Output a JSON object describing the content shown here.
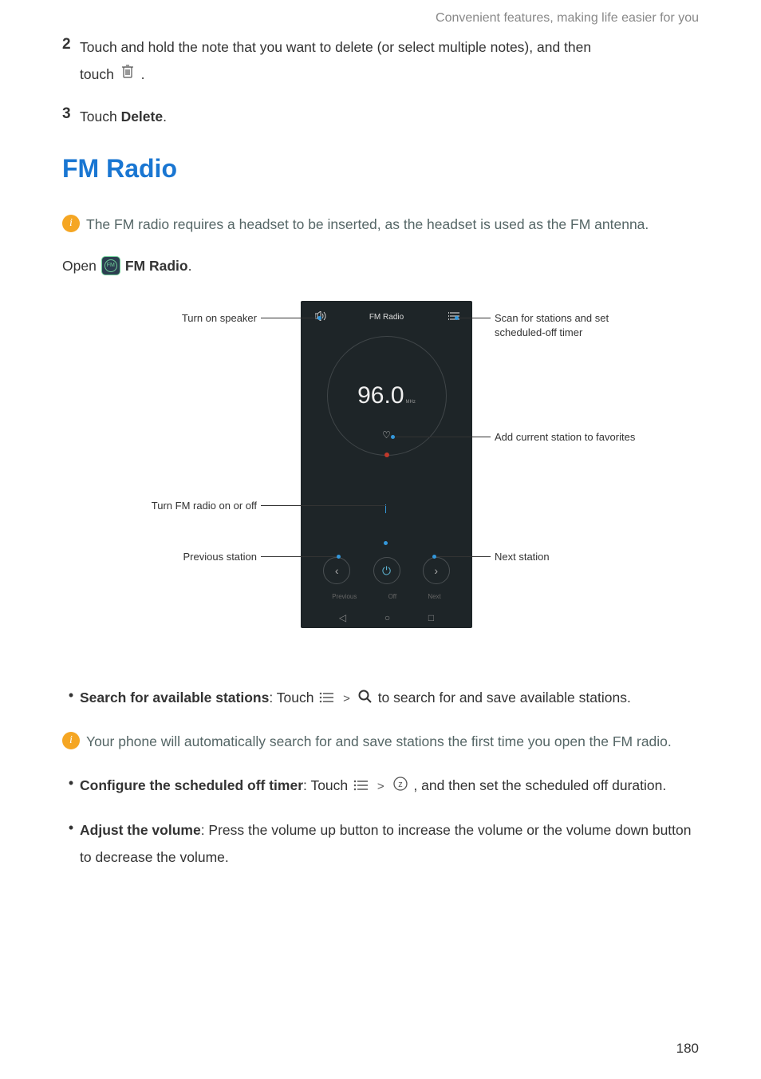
{
  "header": "Convenient features, making life easier for you",
  "step2": {
    "num": "2",
    "text_a": "Touch and hold the note that you want to delete (or select multiple notes), and then",
    "text_b": "touch",
    "text_c": "."
  },
  "step3": {
    "num": "3",
    "text_a": "Touch ",
    "bold": "Delete",
    "text_b": "."
  },
  "title": "FM Radio",
  "info1": "The FM radio requires a headset to be inserted, as the headset is used as the FM antenna.",
  "open_line": {
    "a": "Open",
    "b": "FM Radio",
    "c": "."
  },
  "diagram": {
    "phone_title": "FM Radio",
    "frequency": "96.0",
    "mhz": "MHz",
    "ctrl_prev": "Previous",
    "ctrl_off": "Off",
    "ctrl_next": "Next",
    "label_speaker": "Turn on speaker",
    "label_menu_a": "Scan for stations and set",
    "label_menu_b": "scheduled-off timer",
    "label_heart": "Add current station to favorites",
    "label_power": "Turn FM radio on or off",
    "label_prev": "Previous station",
    "label_next": "Next station"
  },
  "bullets": {
    "search": {
      "bold": "Search for available stations",
      "a": ": Touch ",
      "b": " to search for and save available stations."
    },
    "info2": "Your phone will automatically search for and save stations the first time you open the FM radio.",
    "timer": {
      "bold": "Configure the scheduled off timer",
      "a": ": Touch ",
      "b": " , and then set the scheduled off duration."
    },
    "volume": {
      "bold": "Adjust the volume",
      "a": ": Press the volume up button to increase the volume or the volume down button to decrease the volume."
    }
  },
  "page": "180"
}
